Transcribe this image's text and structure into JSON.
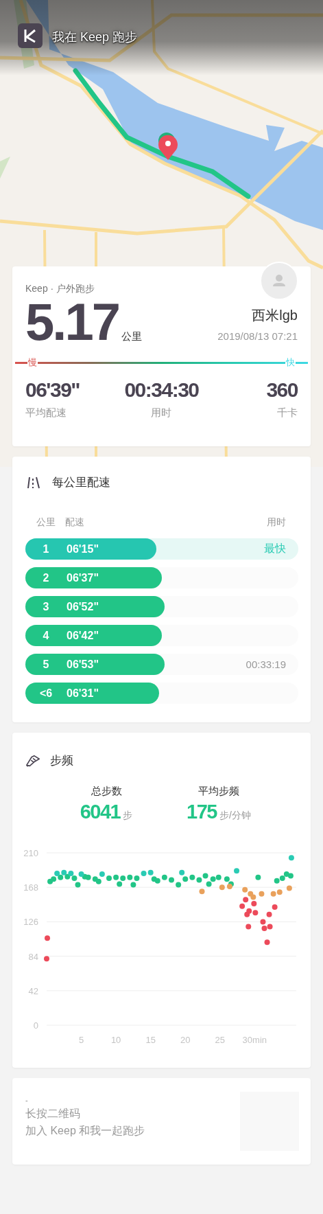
{
  "header": {
    "title": "我在 Keep 跑步"
  },
  "summary": {
    "source": "Keep · 户外跑步",
    "distance": "5.17",
    "distance_unit": "公里",
    "user_name": "西米lgb",
    "datetime": "2019/08/13 07:21",
    "speed_scale": {
      "slow": "慢",
      "fast": "快"
    },
    "stats": [
      {
        "value": "06'39\"",
        "label": "平均配速"
      },
      {
        "value": "00:34:30",
        "label": "用时"
      },
      {
        "value": "360",
        "label": "千卡"
      }
    ]
  },
  "pace": {
    "title": "每公里配速",
    "columns": [
      "公里",
      "配速",
      "用时"
    ],
    "rows": [
      {
        "km": "1",
        "pace": "06'15\"",
        "level": 0.48,
        "fastest": true,
        "badge": "最快"
      },
      {
        "km": "2",
        "pace": "06'37\"",
        "level": 0.5,
        "fastest": false
      },
      {
        "km": "3",
        "pace": "06'52\"",
        "level": 0.51,
        "fastest": false
      },
      {
        "km": "4",
        "pace": "06'42\"",
        "level": 0.5,
        "fastest": false
      },
      {
        "km": "5",
        "pace": "06'53\"",
        "level": 0.51,
        "fastest": false,
        "time": "00:33:19"
      },
      {
        "km": "<6",
        "pace": "06'31\"",
        "level": 0.49,
        "fastest": false
      }
    ]
  },
  "cadence": {
    "title": "步频",
    "stats": [
      {
        "label": "总步数",
        "value": "6041",
        "unit": "步"
      },
      {
        "label": "平均步频",
        "value": "175",
        "unit": "步/分钟"
      }
    ],
    "chart_data": {
      "type": "scatter",
      "grid": true,
      "xlim": [
        0,
        36
      ],
      "ylim": [
        0,
        210
      ],
      "yticks": [
        0,
        42,
        84,
        126,
        168,
        210
      ],
      "xticks": [
        5,
        10,
        15,
        20,
        25,
        {
          "value": 30,
          "label": "30min"
        }
      ],
      "x": [
        0,
        0.1,
        0.5,
        1,
        1.5,
        2,
        2.5,
        3,
        3.5,
        4,
        4.5,
        5,
        5.5,
        6,
        7,
        7.5,
        8,
        9,
        10,
        10.5,
        11,
        12,
        12.5,
        13,
        14,
        15,
        15.5,
        16,
        17,
        18,
        19,
        19.5,
        20,
        21,
        22,
        22.4,
        22.9,
        23.4,
        24,
        24.8,
        25.3,
        26,
        26.4,
        26.6,
        27.4,
        28.2,
        28.6,
        28.7,
        28.9,
        29.1,
        29.2,
        29.4,
        29.8,
        29.9,
        30.1,
        30.5,
        31,
        31.2,
        31.4,
        31.8,
        32.1,
        32.2,
        32.7,
        32.9,
        33.2,
        33.6,
        34,
        34.6,
        35,
        35.2,
        35.3
      ],
      "series": [
        {
          "color": "#22c587",
          "values": [
            null,
            null,
            175,
            178,
            null,
            180,
            null,
            181,
            null,
            179,
            171,
            null,
            181,
            180,
            178,
            175,
            null,
            179,
            180,
            172,
            179,
            180,
            171,
            179,
            null,
            null,
            178,
            176,
            180,
            177,
            171,
            null,
            178,
            180,
            177,
            null,
            182,
            172,
            178,
            180,
            null,
            178,
            null,
            172,
            null,
            null,
            null,
            null,
            null,
            null,
            null,
            null,
            null,
            null,
            null,
            180,
            null,
            null,
            null,
            null,
            null,
            null,
            null,
            null,
            176,
            null,
            179,
            184,
            null,
            182,
            null
          ]
        },
        {
          "color": "#2acbb4",
          "values": [
            null,
            null,
            null,
            null,
            185,
            null,
            186,
            null,
            185,
            null,
            null,
            184,
            null,
            null,
            null,
            null,
            184,
            null,
            null,
            null,
            null,
            null,
            null,
            null,
            185,
            186,
            null,
            null,
            null,
            null,
            null,
            186,
            null,
            null,
            null,
            null,
            null,
            null,
            null,
            null,
            null,
            null,
            null,
            null,
            188,
            null,
            null,
            null,
            null,
            null,
            null,
            null,
            null,
            null,
            null,
            null,
            null,
            null,
            null,
            null,
            null,
            null,
            null,
            null,
            null,
            null,
            null,
            null,
            null,
            null,
            204
          ]
        },
        {
          "color": "#e9a15c",
          "values": [
            null,
            null,
            null,
            null,
            null,
            null,
            null,
            null,
            null,
            null,
            null,
            null,
            null,
            null,
            null,
            null,
            null,
            null,
            null,
            null,
            null,
            null,
            null,
            null,
            null,
            null,
            null,
            null,
            null,
            null,
            null,
            null,
            null,
            null,
            null,
            163,
            null,
            null,
            null,
            null,
            168,
            null,
            169,
            null,
            null,
            null,
            165,
            null,
            null,
            null,
            null,
            160,
            156,
            null,
            null,
            null,
            160,
            null,
            null,
            null,
            null,
            null,
            160,
            null,
            null,
            162,
            null,
            null,
            167,
            null,
            null
          ]
        },
        {
          "color": "#ec4a5a",
          "values": [
            81,
            106,
            null,
            null,
            null,
            null,
            null,
            null,
            null,
            null,
            null,
            null,
            null,
            null,
            null,
            null,
            null,
            null,
            null,
            null,
            null,
            null,
            null,
            null,
            null,
            null,
            null,
            null,
            null,
            null,
            null,
            null,
            null,
            null,
            null,
            null,
            null,
            null,
            null,
            null,
            null,
            null,
            null,
            null,
            null,
            145,
            null,
            153,
            135,
            120,
            139,
            null,
            null,
            148,
            137,
            null,
            null,
            126,
            118,
            101,
            135,
            120,
            null,
            144,
            null,
            null,
            null,
            null,
            null,
            null,
            null
          ]
        }
      ]
    }
  },
  "footer": {
    "dash": "-",
    "lines": [
      "长按二维码",
      "加入 Keep 和我一起跑步"
    ]
  }
}
